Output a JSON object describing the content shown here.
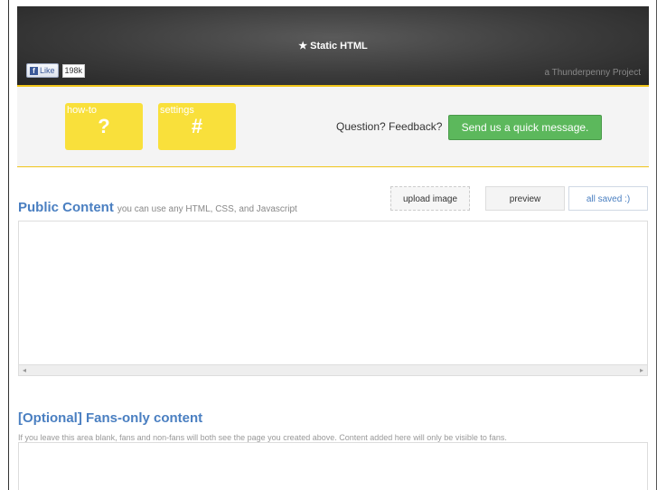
{
  "header": {
    "title": "★ Static HTML",
    "subtitle": "a Thunderpenny Project",
    "fb_like_label": "Like",
    "fb_count": "198k"
  },
  "toolbar": {
    "tiles": [
      {
        "label": "how-to",
        "symbol": "?"
      },
      {
        "label": "settings",
        "symbol": "#"
      }
    ],
    "question": "Question? Feedback?",
    "send_button": "Send us a quick message."
  },
  "actions": {
    "upload": "upload image",
    "preview": "preview",
    "status": "all saved :)"
  },
  "public_section": {
    "title": "Public Content",
    "hint": "you can use any HTML, CSS, and Javascript"
  },
  "fans_section": {
    "title": "[Optional] Fans-only content",
    "description": "If you leave this area blank, fans and non-fans will both see the page you created above. Content added here will only be visible to fans."
  },
  "scrollbar": {
    "left_arrow": "◂",
    "right_arrow": "▸"
  },
  "colors": {
    "accent": "#4a7fc1",
    "tile": "#f9e03b",
    "send": "#5cb85c",
    "divider": "#f0c419"
  }
}
